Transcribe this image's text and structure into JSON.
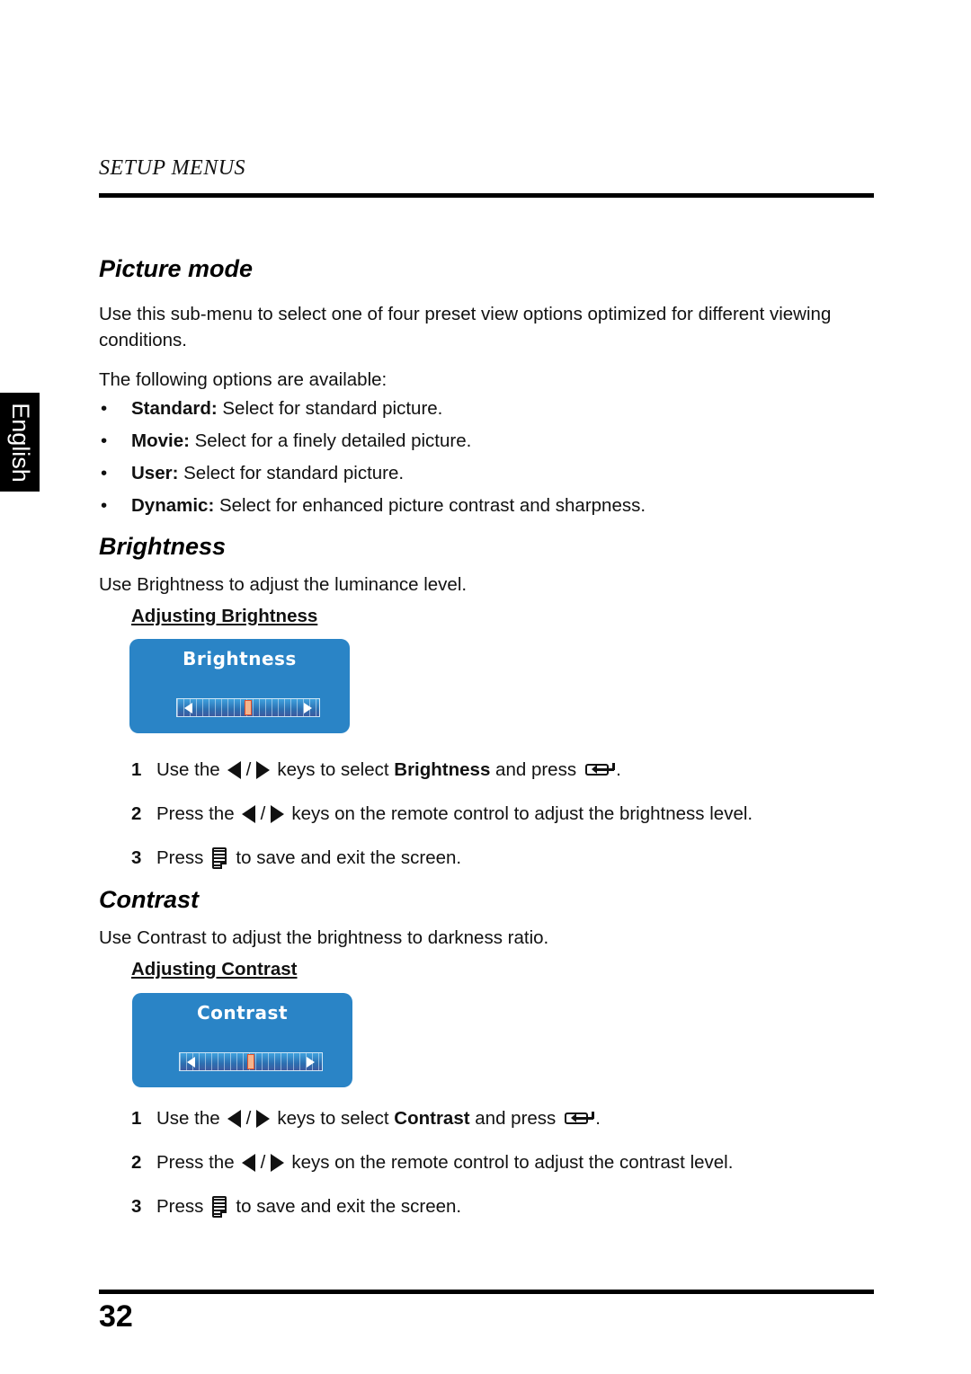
{
  "header": {
    "running_head": "SETUP MENUS"
  },
  "language_tab": {
    "label": "English"
  },
  "sections": {
    "picture_mode": {
      "title": "Picture mode",
      "intro": "Use this sub-menu to select one of four preset view options optimized for different viewing conditions.",
      "options_lead": "The following options are available:",
      "options": [
        {
          "name": "Standard:",
          "desc": " Select for standard picture."
        },
        {
          "name": "Movie:",
          "desc": " Select for a finely detailed picture."
        },
        {
          "name": "User:",
          "desc": " Select for standard picture."
        },
        {
          "name": "Dynamic:",
          "desc": " Select for enhanced picture contrast and sharpness."
        }
      ]
    },
    "brightness": {
      "title": "Brightness",
      "intro": "Use Brightness to adjust the luminance level.",
      "subheading": "Adjusting Brightness",
      "osd": {
        "title": "Brightness",
        "level_fraction": 0.5,
        "left_arrow_icon": "left-arrow-icon",
        "right_arrow_icon": "right-arrow-icon"
      },
      "steps": [
        {
          "num": "1",
          "pre": "Use the",
          "sep": "/",
          "mid": "keys to select",
          "bold": "Brightness",
          "post": "and press",
          "end": "."
        },
        {
          "num": "2",
          "pre": "Press the",
          "sep": "/",
          "post": "keys on the remote control to adjust the brightness level."
        },
        {
          "num": "3",
          "pre": "Press",
          "post": "to save and exit the screen."
        }
      ]
    },
    "contrast": {
      "title": "Contrast",
      "intro": "Use Contrast to adjust the brightness to darkness ratio.",
      "subheading": "Adjusting Contrast",
      "osd": {
        "title": "Contrast",
        "level_fraction": 0.5,
        "left_arrow_icon": "left-arrow-icon",
        "right_arrow_icon": "right-arrow-icon"
      },
      "steps": [
        {
          "num": "1",
          "pre": "Use the",
          "sep": "/",
          "mid": "keys to select",
          "bold": "Contrast",
          "post": "and press",
          "end": "."
        },
        {
          "num": "2",
          "pre": "Press the",
          "sep": "/",
          "post": "keys on the remote control to adjust the contrast level."
        },
        {
          "num": "3",
          "pre": "Press",
          "post": "to save and exit the screen."
        }
      ]
    }
  },
  "footer": {
    "page_number": "32"
  },
  "colors": {
    "osd_blue": "#2a84c6",
    "thumb_fill": "#f5b48c",
    "thumb_border": "#e0512d"
  }
}
